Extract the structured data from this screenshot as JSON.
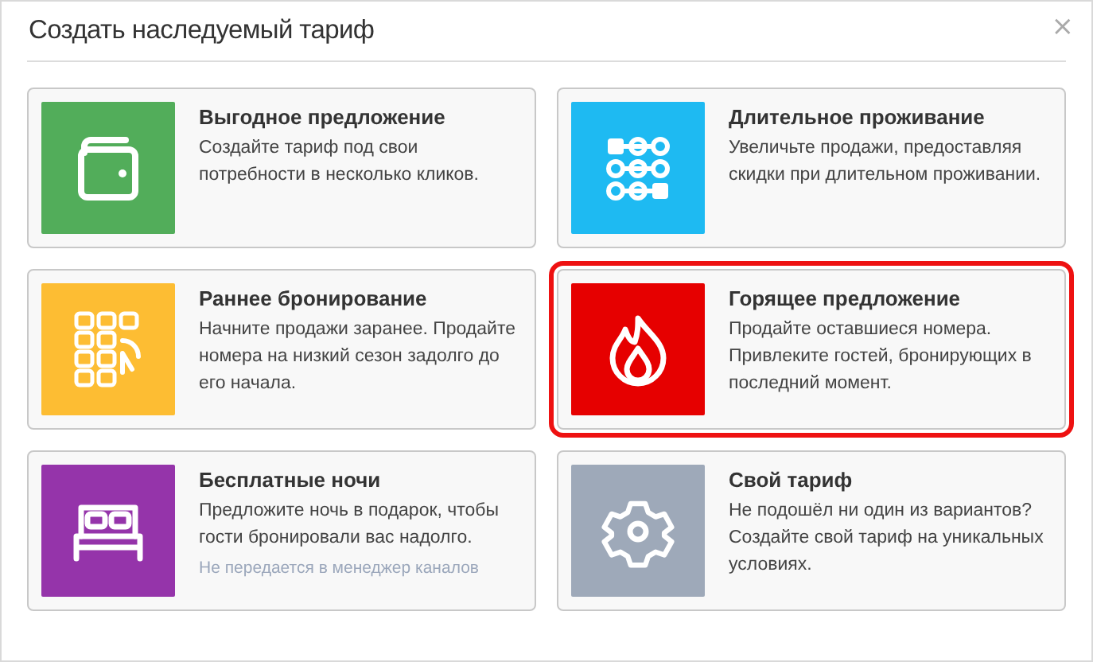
{
  "dialog": {
    "title": "Создать наследуемый тариф",
    "close": "×"
  },
  "cards": [
    {
      "kind": "wallet",
      "color": "#52ad5a",
      "title": "Выгодное предложение",
      "description": "Создайте тариф под свои потребности в несколько кликов.",
      "selected": false
    },
    {
      "kind": "dots",
      "color": "#1ebaf2",
      "title": "Длительное проживание",
      "description": "Увеличьте продажи, предоставляя скидки при длительном проживании.",
      "selected": false
    },
    {
      "kind": "calendar",
      "color": "#fdbd33",
      "title": "Раннее бронирование",
      "description": "Начните продажи заранее. Продайте номера на низкий сезон задолго до его начала.",
      "selected": false
    },
    {
      "kind": "flame",
      "color": "#e60000",
      "title": "Горящее предложение",
      "description": "Продайте оставшиеся номера. Привлеките гостей, бронирующих в последний момент.",
      "selected": true
    },
    {
      "kind": "bed",
      "color": "#9534aa",
      "title": "Бесплатные ночи",
      "description": "Предложите ночь в подарок, чтобы гости бронировали вас надолго.",
      "note": "Не передается в менеджер каналов",
      "selected": false
    },
    {
      "kind": "gear",
      "color": "#9ea9b9",
      "title": "Свой тариф",
      "description": "Не подошёл ни один из вариантов? Создайте свой тариф на уникальных условиях.",
      "selected": false
    }
  ]
}
